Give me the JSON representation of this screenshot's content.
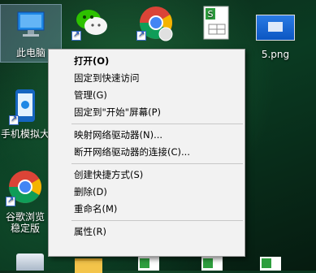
{
  "desktop": {
    "icons": [
      {
        "name": "此电脑",
        "type": "this-pc"
      },
      {
        "name": "",
        "type": "wechat"
      },
      {
        "name": "",
        "type": "chrome"
      },
      {
        "name": "",
        "type": "sheet"
      },
      {
        "name": "5.png",
        "type": "image"
      },
      {
        "name": "手机模拟大",
        "type": "phone"
      },
      {
        "name": "谷歌浏览器稳定版",
        "type": "chrome2"
      }
    ],
    "labels": {
      "this_pc": "此电脑",
      "png": "5.png",
      "phone": "手机模拟大",
      "chrome_line1": "谷歌浏览",
      "chrome_line2": "稳定版"
    }
  },
  "context_menu": {
    "items": [
      {
        "label": "打开(O)",
        "bold": true
      },
      {
        "label": "固定到快速访问"
      },
      {
        "label": "管理(G)"
      },
      {
        "label": "固定到\"开始\"屏幕(P)"
      },
      {
        "label": "映射网络驱动器(N)..."
      },
      {
        "label": "断开网络驱动器的连接(C)..."
      },
      {
        "label": "创建快捷方式(S)"
      },
      {
        "label": "删除(D)"
      },
      {
        "label": "重命名(M)"
      },
      {
        "label": "属性(R)"
      }
    ]
  }
}
